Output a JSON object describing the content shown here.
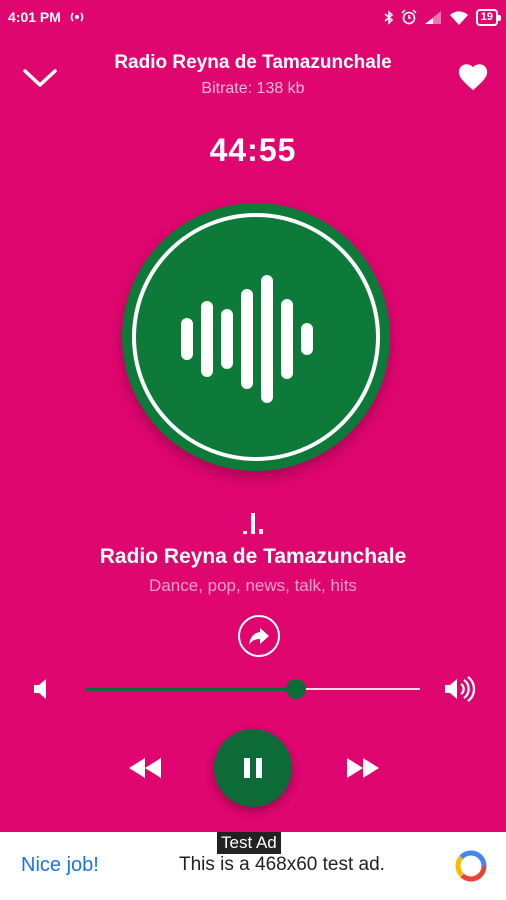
{
  "status_bar": {
    "time": "4:01 PM",
    "battery": "19"
  },
  "header": {
    "title": "Radio Reyna de Tamazunchale",
    "bitrate": "Bitrate: 138 kb"
  },
  "player": {
    "elapsed": "44:55",
    "station_name": "Radio Reyna de Tamazunchale",
    "genres": "Dance, pop, news, talk, hits",
    "volume": 0.63,
    "state": "playing"
  },
  "ad": {
    "tag": "Test Ad",
    "cta": "Nice job!",
    "text": "This is a 468x60 test ad."
  },
  "colors": {
    "background": "#E0066F",
    "accent": "#0D6B37",
    "art": "#0D7A3A"
  },
  "icons": [
    "chevron-down-icon",
    "heart-icon",
    "equalizer-icon",
    "share-icon",
    "volume-low-icon",
    "volume-high-icon",
    "rewind-icon",
    "pause-icon",
    "fast-forward-icon"
  ]
}
